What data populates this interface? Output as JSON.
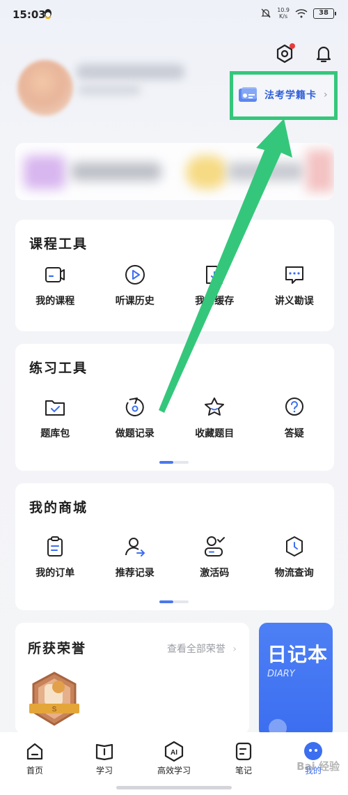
{
  "status_bar": {
    "time": "15:03",
    "net_speed_value": "10.9",
    "net_speed_unit": "K/s",
    "battery": "38"
  },
  "header": {
    "settings_icon": "settings-hex-icon",
    "bell_icon": "bell-icon",
    "study_card_label": "法考学籍卡"
  },
  "course_tools": {
    "title": "课程工具",
    "items": [
      {
        "label": "我的课程",
        "icon": "course-video-icon"
      },
      {
        "label": "听课历史",
        "icon": "play-history-icon"
      },
      {
        "label": "我的缓存",
        "icon": "download-cache-icon"
      },
      {
        "label": "讲义勘误",
        "icon": "chat-errata-icon"
      }
    ]
  },
  "practice_tools": {
    "title": "练习工具",
    "items": [
      {
        "label": "题库包",
        "icon": "folder-check-icon"
      },
      {
        "label": "做题记录",
        "icon": "practice-record-icon"
      },
      {
        "label": "收藏题目",
        "icon": "star-icon"
      },
      {
        "label": "答疑",
        "icon": "question-icon"
      }
    ]
  },
  "mall": {
    "title": "我的商城",
    "items": [
      {
        "label": "我的订单",
        "icon": "order-clipboard-icon"
      },
      {
        "label": "推荐记录",
        "icon": "referral-user-icon"
      },
      {
        "label": "激活码",
        "icon": "activation-code-icon"
      },
      {
        "label": "物流查询",
        "icon": "logistics-icon"
      }
    ]
  },
  "honors": {
    "title": "所获荣誉",
    "view_all": "查看全部荣誉",
    "badge_text": "S"
  },
  "diary": {
    "title": "日记本",
    "subtitle": "DIARY"
  },
  "bottom_nav": {
    "items": [
      {
        "label": "首页",
        "icon": "home-icon"
      },
      {
        "label": "学习",
        "icon": "book-icon"
      },
      {
        "label": "高效学习",
        "icon": "ai-icon"
      },
      {
        "label": "笔记",
        "icon": "note-icon"
      },
      {
        "label": "我的",
        "icon": "profile-icon",
        "active": true
      }
    ]
  },
  "watermark": "Bai 经验",
  "colors": {
    "accent": "#3c6ef0",
    "highlight": "#34c77b",
    "badge_red": "#e93b3b"
  }
}
